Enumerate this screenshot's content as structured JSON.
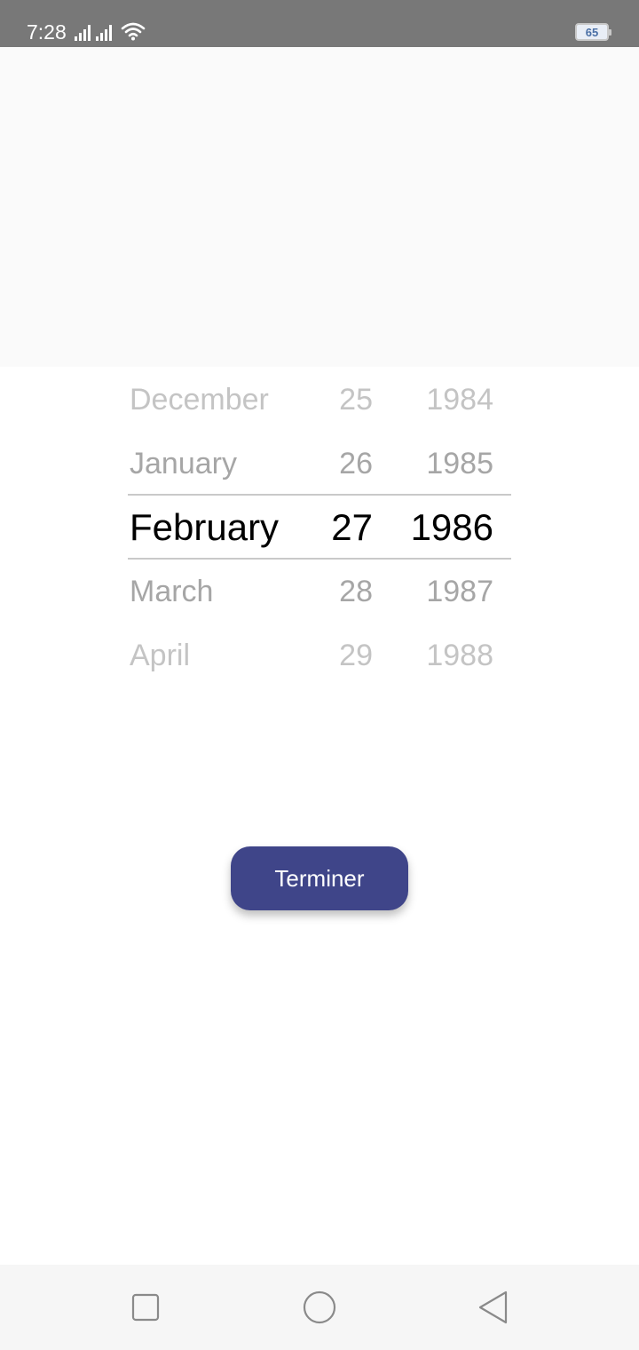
{
  "status_bar": {
    "time": "7:28",
    "battery": "65",
    "icons": [
      "signal-icon",
      "signal-icon",
      "wifi-icon",
      "battery-icon"
    ]
  },
  "picker": {
    "months": [
      {
        "label": "December"
      },
      {
        "label": "January"
      },
      {
        "label": "February"
      },
      {
        "label": "March"
      },
      {
        "label": "April"
      }
    ],
    "days": [
      {
        "label": "25"
      },
      {
        "label": "26"
      },
      {
        "label": "27"
      },
      {
        "label": "28"
      },
      {
        "label": "29"
      }
    ],
    "years": [
      {
        "label": "1984"
      },
      {
        "label": "1985"
      },
      {
        "label": "1986"
      },
      {
        "label": "1987"
      },
      {
        "label": "1988"
      }
    ],
    "selected": {
      "month": "February",
      "day": "27",
      "year": "1986"
    }
  },
  "actions": {
    "done_label": "Terminer"
  },
  "colors": {
    "accent": "#3f4589",
    "status_bar": "#787878",
    "header_bg": "#fafafa",
    "nav_bg": "#f6f6f6"
  },
  "nav_bar": {
    "icons": [
      "square-recents-icon",
      "circle-home-icon",
      "triangle-back-icon"
    ]
  }
}
